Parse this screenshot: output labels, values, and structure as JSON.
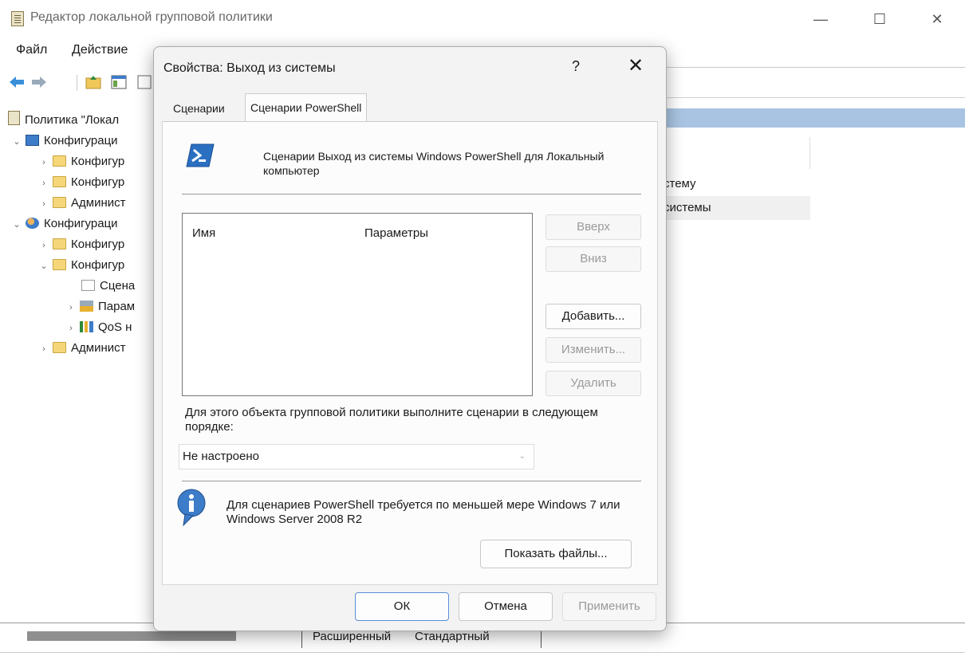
{
  "app": {
    "title": "Редактор локальной групповой политики",
    "menu": [
      "Файл",
      "Действие"
    ],
    "window_controls": {
      "minimize": "—",
      "maximize": "☐",
      "close": "✕"
    }
  },
  "tree": [
    {
      "label": "Политика \"Локал",
      "icon": "policy-icon",
      "chevron": ""
    },
    {
      "label": "Конфигураци",
      "icon": "computer-icon",
      "chevron": "⌄"
    },
    {
      "label": "Конфигур",
      "icon": "folder-icon",
      "chevron": "›"
    },
    {
      "label": "Конфигур",
      "icon": "folder-icon",
      "chevron": "›"
    },
    {
      "label": "Админист",
      "icon": "folder-icon",
      "chevron": "›"
    },
    {
      "label": "Конфигураци",
      "icon": "users-icon",
      "chevron": "⌄"
    },
    {
      "label": "Конфигур",
      "icon": "folder-icon",
      "chevron": "›"
    },
    {
      "label": "Конфигур",
      "icon": "folder-icon",
      "chevron": "⌄"
    },
    {
      "label": "Сцена",
      "icon": "scripts-icon",
      "chevron": ""
    },
    {
      "label": "Парам",
      "icon": "settings-icon",
      "chevron": "›"
    },
    {
      "label": "QoS н",
      "icon": "chart-icon",
      "chevron": "›"
    },
    {
      "label": "Админист",
      "icon": "folder-icon",
      "chevron": "›"
    }
  ],
  "right_list": [
    "стему",
    "системы"
  ],
  "bottom_tabs": [
    "Расширенный",
    "Стандартный"
  ],
  "dialog": {
    "title": "Свойства: Выход из системы",
    "help": "?",
    "close": "✕",
    "tabs": [
      "Сценарии",
      "Сценарии PowerShell"
    ],
    "header_text": "Сценарии Выход из системы Windows PowerShell для Локальный компьютер",
    "columns": [
      "Имя",
      "Параметры"
    ],
    "side_buttons": {
      "up": "Вверх",
      "down": "Вниз",
      "add": "Добавить...",
      "edit": "Изменить...",
      "remove": "Удалить"
    },
    "order_label": "Для этого объекта групповой политики выполните сценарии в следующем порядке:",
    "order_value": "Не настроено",
    "info_text": "Для сценариев PowerShell требуется по меньшей мере Windows 7 или Windows Server 2008 R2",
    "show_files": "Показать файлы...",
    "ok": "ОК",
    "cancel": "Отмена",
    "apply": "Применить"
  },
  "colors": {
    "accent": "#5a8fd8",
    "selection_header": "#a9c4e2",
    "powershell": "#2a6fc0"
  }
}
